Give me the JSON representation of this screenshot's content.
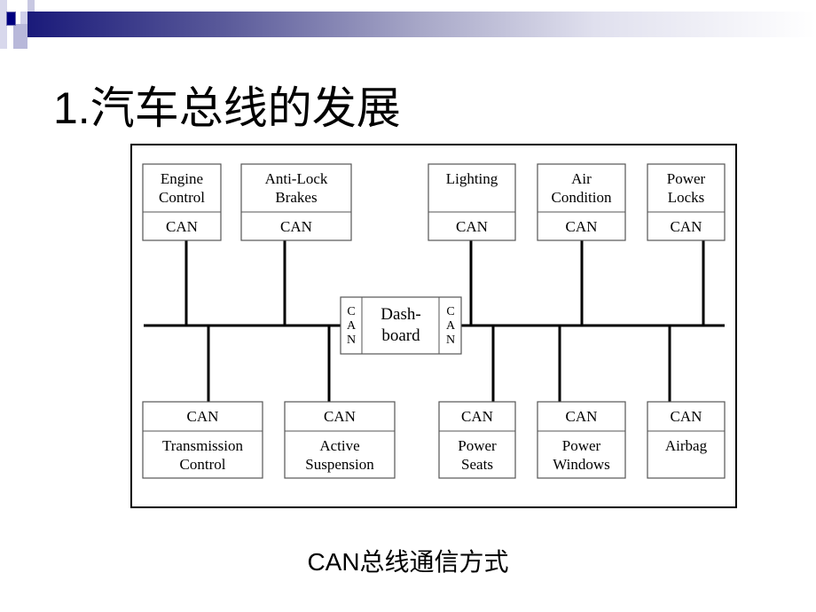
{
  "title": "1.汽车总线的发展",
  "caption": "CAN总线通信方式",
  "colors": {
    "accent": "#000080",
    "bar_start": "#1a1a7a"
  },
  "diagram": {
    "can_label": "CAN",
    "dashboard": {
      "line1": "Dash-",
      "line2": "board",
      "side": [
        "C",
        "A",
        "N"
      ]
    },
    "top_nodes": [
      {
        "line1": "Engine",
        "line2": "Control"
      },
      {
        "line1": "Anti-Lock",
        "line2": "Brakes"
      },
      {
        "line1": "Lighting",
        "line2": ""
      },
      {
        "line1": "Air",
        "line2": "Condition"
      },
      {
        "line1": "Power",
        "line2": "Locks"
      }
    ],
    "bottom_nodes": [
      {
        "line1": "Transmission",
        "line2": "Control"
      },
      {
        "line1": "Active",
        "line2": "Suspension"
      },
      {
        "line1": "Power",
        "line2": "Seats"
      },
      {
        "line1": "Power",
        "line2": "Windows"
      },
      {
        "line1": "Airbag",
        "line2": ""
      }
    ]
  }
}
